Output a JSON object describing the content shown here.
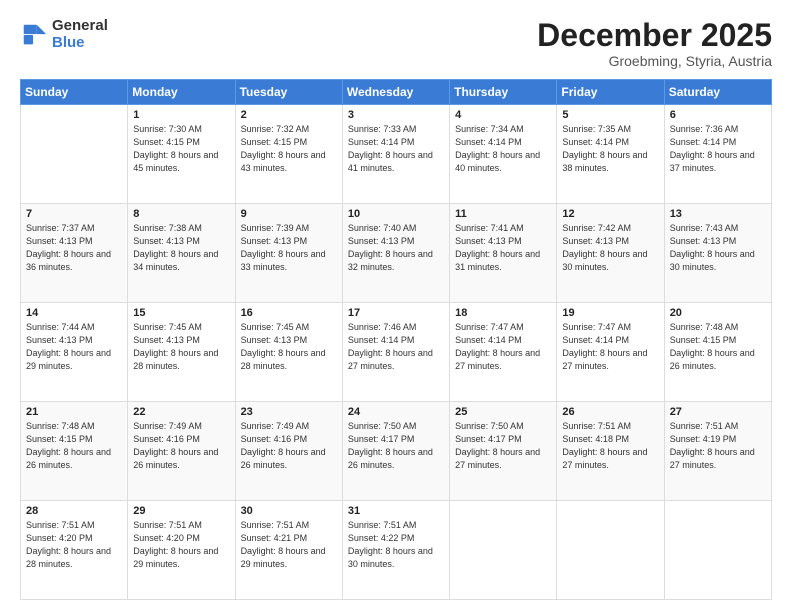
{
  "logo": {
    "general": "General",
    "blue": "Blue"
  },
  "header": {
    "month": "December 2025",
    "location": "Groebming, Styria, Austria"
  },
  "weekdays": [
    "Sunday",
    "Monday",
    "Tuesday",
    "Wednesday",
    "Thursday",
    "Friday",
    "Saturday"
  ],
  "weeks": [
    [
      {
        "day": "",
        "sunrise": "",
        "sunset": "",
        "daylight": ""
      },
      {
        "day": "1",
        "sunrise": "7:30 AM",
        "sunset": "4:15 PM",
        "daylight": "8 hours and 45 minutes."
      },
      {
        "day": "2",
        "sunrise": "7:32 AM",
        "sunset": "4:15 PM",
        "daylight": "8 hours and 43 minutes."
      },
      {
        "day": "3",
        "sunrise": "7:33 AM",
        "sunset": "4:14 PM",
        "daylight": "8 hours and 41 minutes."
      },
      {
        "day": "4",
        "sunrise": "7:34 AM",
        "sunset": "4:14 PM",
        "daylight": "8 hours and 40 minutes."
      },
      {
        "day": "5",
        "sunrise": "7:35 AM",
        "sunset": "4:14 PM",
        "daylight": "8 hours and 38 minutes."
      },
      {
        "day": "6",
        "sunrise": "7:36 AM",
        "sunset": "4:14 PM",
        "daylight": "8 hours and 37 minutes."
      }
    ],
    [
      {
        "day": "7",
        "sunrise": "7:37 AM",
        "sunset": "4:13 PM",
        "daylight": "8 hours and 36 minutes."
      },
      {
        "day": "8",
        "sunrise": "7:38 AM",
        "sunset": "4:13 PM",
        "daylight": "8 hours and 34 minutes."
      },
      {
        "day": "9",
        "sunrise": "7:39 AM",
        "sunset": "4:13 PM",
        "daylight": "8 hours and 33 minutes."
      },
      {
        "day": "10",
        "sunrise": "7:40 AM",
        "sunset": "4:13 PM",
        "daylight": "8 hours and 32 minutes."
      },
      {
        "day": "11",
        "sunrise": "7:41 AM",
        "sunset": "4:13 PM",
        "daylight": "8 hours and 31 minutes."
      },
      {
        "day": "12",
        "sunrise": "7:42 AM",
        "sunset": "4:13 PM",
        "daylight": "8 hours and 30 minutes."
      },
      {
        "day": "13",
        "sunrise": "7:43 AM",
        "sunset": "4:13 PM",
        "daylight": "8 hours and 30 minutes."
      }
    ],
    [
      {
        "day": "14",
        "sunrise": "7:44 AM",
        "sunset": "4:13 PM",
        "daylight": "8 hours and 29 minutes."
      },
      {
        "day": "15",
        "sunrise": "7:45 AM",
        "sunset": "4:13 PM",
        "daylight": "8 hours and 28 minutes."
      },
      {
        "day": "16",
        "sunrise": "7:45 AM",
        "sunset": "4:13 PM",
        "daylight": "8 hours and 28 minutes."
      },
      {
        "day": "17",
        "sunrise": "7:46 AM",
        "sunset": "4:14 PM",
        "daylight": "8 hours and 27 minutes."
      },
      {
        "day": "18",
        "sunrise": "7:47 AM",
        "sunset": "4:14 PM",
        "daylight": "8 hours and 27 minutes."
      },
      {
        "day": "19",
        "sunrise": "7:47 AM",
        "sunset": "4:14 PM",
        "daylight": "8 hours and 27 minutes."
      },
      {
        "day": "20",
        "sunrise": "7:48 AM",
        "sunset": "4:15 PM",
        "daylight": "8 hours and 26 minutes."
      }
    ],
    [
      {
        "day": "21",
        "sunrise": "7:48 AM",
        "sunset": "4:15 PM",
        "daylight": "8 hours and 26 minutes."
      },
      {
        "day": "22",
        "sunrise": "7:49 AM",
        "sunset": "4:16 PM",
        "daylight": "8 hours and 26 minutes."
      },
      {
        "day": "23",
        "sunrise": "7:49 AM",
        "sunset": "4:16 PM",
        "daylight": "8 hours and 26 minutes."
      },
      {
        "day": "24",
        "sunrise": "7:50 AM",
        "sunset": "4:17 PM",
        "daylight": "8 hours and 26 minutes."
      },
      {
        "day": "25",
        "sunrise": "7:50 AM",
        "sunset": "4:17 PM",
        "daylight": "8 hours and 27 minutes."
      },
      {
        "day": "26",
        "sunrise": "7:51 AM",
        "sunset": "4:18 PM",
        "daylight": "8 hours and 27 minutes."
      },
      {
        "day": "27",
        "sunrise": "7:51 AM",
        "sunset": "4:19 PM",
        "daylight": "8 hours and 27 minutes."
      }
    ],
    [
      {
        "day": "28",
        "sunrise": "7:51 AM",
        "sunset": "4:20 PM",
        "daylight": "8 hours and 28 minutes."
      },
      {
        "day": "29",
        "sunrise": "7:51 AM",
        "sunset": "4:20 PM",
        "daylight": "8 hours and 29 minutes."
      },
      {
        "day": "30",
        "sunrise": "7:51 AM",
        "sunset": "4:21 PM",
        "daylight": "8 hours and 29 minutes."
      },
      {
        "day": "31",
        "sunrise": "7:51 AM",
        "sunset": "4:22 PM",
        "daylight": "8 hours and 30 minutes."
      },
      {
        "day": "",
        "sunrise": "",
        "sunset": "",
        "daylight": ""
      },
      {
        "day": "",
        "sunrise": "",
        "sunset": "",
        "daylight": ""
      },
      {
        "day": "",
        "sunrise": "",
        "sunset": "",
        "daylight": ""
      }
    ]
  ]
}
